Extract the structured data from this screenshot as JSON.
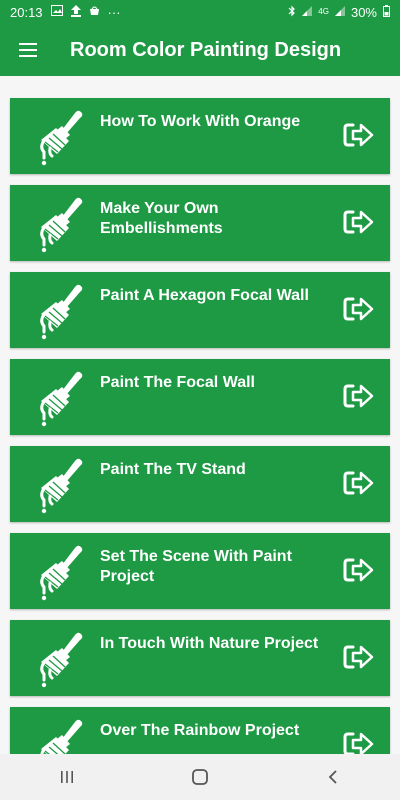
{
  "status_bar": {
    "time": "20:13",
    "notification_icons": [
      "image-icon",
      "upload-icon",
      "app-icon",
      "more-icon"
    ],
    "more": "···",
    "network": "4G",
    "battery": "30%"
  },
  "app_bar": {
    "title": "Room Color Painting Design"
  },
  "items": [
    {
      "label": "How To Work With Orange"
    },
    {
      "label": "Make Your Own Embellishments"
    },
    {
      "label": "Paint A Hexagon Focal Wall"
    },
    {
      "label": "Paint The Focal Wall"
    },
    {
      "label": "Paint The TV Stand"
    },
    {
      "label": "Set The Scene With Paint Project"
    },
    {
      "label": "In Touch With Nature Project"
    },
    {
      "label": "Over The Rainbow Project"
    }
  ],
  "colors": {
    "primary": "#1e9a45",
    "background": "#f6f6f6",
    "nav_bar": "#f1f1f1"
  }
}
